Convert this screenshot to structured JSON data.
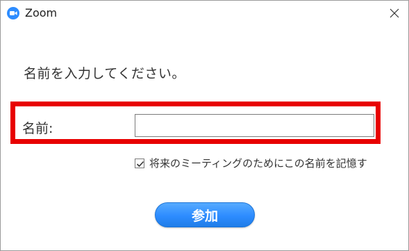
{
  "window": {
    "title": "Zoom",
    "accent_color": "#2d8cff",
    "app_icon": "zoom-camera-icon",
    "close_icon": "close-icon"
  },
  "dialog": {
    "prompt": "名前を入力してください。",
    "name_label": "名前:",
    "name_value": "",
    "remember_label": "将来のミーティングのためにこの名前を記憶す",
    "remember_checked": true,
    "join_label": "参加",
    "highlight_color": "#e80000"
  }
}
